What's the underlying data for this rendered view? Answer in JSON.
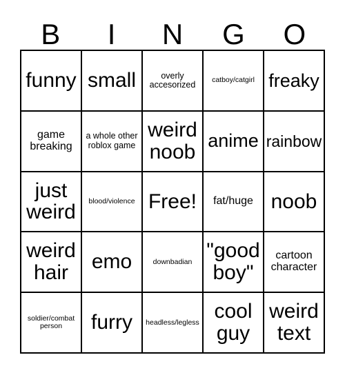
{
  "card": {
    "header_letters": [
      "B",
      "I",
      "N",
      "G",
      "O"
    ],
    "rows": [
      [
        {
          "text": "funny",
          "size": "fs-xl"
        },
        {
          "text": "small",
          "size": "fs-xl"
        },
        {
          "text": "overly accesorized",
          "size": "fs-xs"
        },
        {
          "text": "catboy/catgirl",
          "size": "fs-xxs"
        },
        {
          "text": "freaky",
          "size": "fs-lg"
        }
      ],
      [
        {
          "text": "game breaking",
          "size": "fs-sm"
        },
        {
          "text": "a whole other roblox game",
          "size": "fs-xs"
        },
        {
          "text": "weird noob",
          "size": "fs-xl"
        },
        {
          "text": "anime",
          "size": "fs-lg"
        },
        {
          "text": "rainbow",
          "size": "fs-md"
        }
      ],
      [
        {
          "text": "just weird",
          "size": "fs-xl"
        },
        {
          "text": "blood/violence",
          "size": "fs-xxs"
        },
        {
          "text": "Free!",
          "size": "fs-xl"
        },
        {
          "text": "fat/huge",
          "size": "fs-sm"
        },
        {
          "text": "noob",
          "size": "fs-xl"
        }
      ],
      [
        {
          "text": "weird hair",
          "size": "fs-xl"
        },
        {
          "text": "emo",
          "size": "fs-xl"
        },
        {
          "text": "downbadian",
          "size": "fs-xxs"
        },
        {
          "text": "\"good boy\"",
          "size": "fs-xl"
        },
        {
          "text": "cartoon character",
          "size": "fs-sm"
        }
      ],
      [
        {
          "text": "soldier/combat person",
          "size": "fs-xxs"
        },
        {
          "text": "furry",
          "size": "fs-xl"
        },
        {
          "text": "headless/legless",
          "size": "fs-xxs"
        },
        {
          "text": "cool guy",
          "size": "fs-xl"
        },
        {
          "text": "weird text",
          "size": "fs-xl"
        }
      ]
    ],
    "colors": {
      "background": "#ffffff",
      "border": "#000000",
      "text": "#000000"
    }
  }
}
